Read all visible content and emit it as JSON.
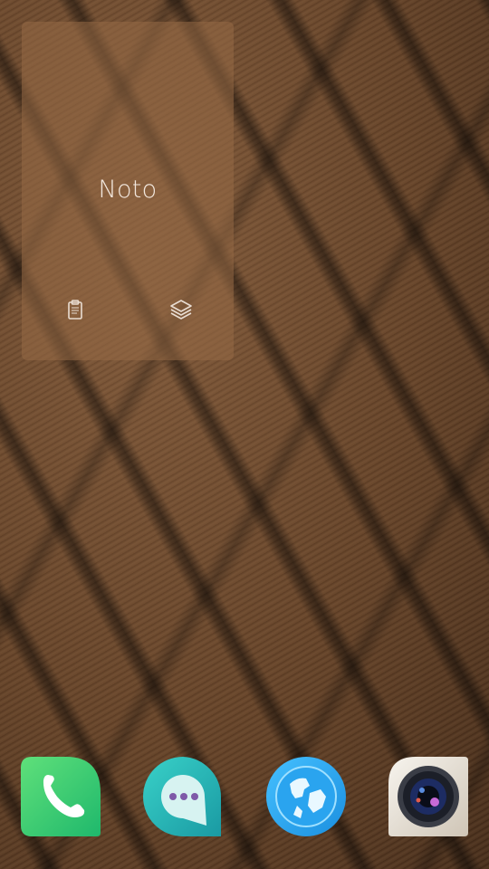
{
  "widget": {
    "title": "Noto",
    "icons": [
      "clipboard-icon",
      "layers-icon"
    ]
  },
  "dock": {
    "apps": [
      {
        "name": "phone-icon",
        "color": "#2ecc71"
      },
      {
        "name": "messages-icon",
        "color": "#2bb7b3"
      },
      {
        "name": "browser-icon",
        "color": "#29a8f0"
      },
      {
        "name": "camera-icon",
        "color": "#2a3a6a"
      }
    ]
  }
}
